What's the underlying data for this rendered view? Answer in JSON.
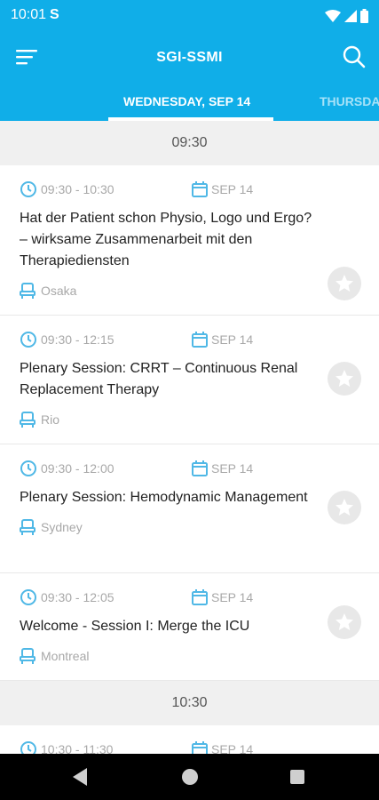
{
  "status_bar": {
    "time": "10:01",
    "notification_icon": "S"
  },
  "toolbar": {
    "title": "SGI-SSMI"
  },
  "tabs": [
    {
      "label": "WEDNESDAY, SEP 14",
      "active": true
    },
    {
      "label": "THURSDAY",
      "active": false
    }
  ],
  "sections": [
    {
      "time": "09:30",
      "sessions": [
        {
          "time_range": "09:30 - 10:30",
          "date": "SEP 14",
          "title": "Hat der Patient schon Physio, Logo und Ergo? – wirksame Zusammenarbeit mit den Therapiediensten",
          "room": "Osaka"
        },
        {
          "time_range": "09:30 - 12:15",
          "date": "SEP 14",
          "title": "Plenary Session: CRRT – Continuous Renal Replacement Therapy",
          "room": "Rio"
        },
        {
          "time_range": "09:30 - 12:00",
          "date": "SEP 14",
          "title": "Plenary Session: Hemodynamic Management",
          "room": "Sydney"
        },
        {
          "time_range": "09:30 - 12:05",
          "date": "SEP 14",
          "title": "Welcome - Session I: Merge the ICU",
          "room": "Montreal"
        }
      ]
    },
    {
      "time": "10:30",
      "sessions": [
        {
          "time_range": "10:30 - 11:30",
          "date": "SEP 14",
          "title": "",
          "room": ""
        }
      ]
    }
  ],
  "colors": {
    "primary": "#10aee8",
    "accent_icon": "#4fb8e6",
    "meta_text": "#a8a8a8"
  }
}
